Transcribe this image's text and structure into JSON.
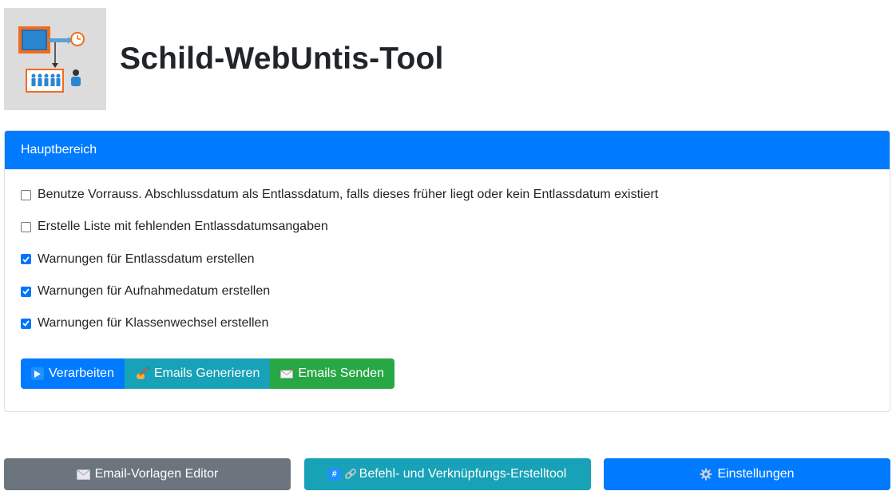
{
  "app": {
    "title": "Schild-WebUntis-Tool",
    "logo_icon": "school-schedule-logo-icon"
  },
  "card": {
    "header": "Hauptbereich",
    "options": [
      {
        "label": "Benutze Vorrauss. Abschlussdatum als Entlassdatum, falls dieses früher liegt oder kein Entlassdatum existiert",
        "checked": false
      },
      {
        "label": "Erstelle Liste mit fehlenden Entlassdatumsangaben",
        "checked": false
      },
      {
        "label": "Warnungen für Entlassdatum erstellen",
        "checked": true
      },
      {
        "label": "Warnungen für Aufnahmedatum erstellen",
        "checked": true
      },
      {
        "label": "Warnungen für Klassenwechsel erstellen",
        "checked": true
      }
    ],
    "actions": {
      "process": {
        "label": "Verarbeiten",
        "icon": "play-icon"
      },
      "generate": {
        "label": "Emails Generieren",
        "icon": "writing-hand-icon"
      },
      "send": {
        "label": "Emails Senden",
        "icon": "envelope-icon"
      }
    }
  },
  "footer": {
    "template_editor": {
      "label": "Email-Vorlagen Editor",
      "icon": "envelope-icon"
    },
    "command_tool": {
      "label": "Befehl- und Verknüpfungs-Erstelltool",
      "icons": [
        "hash-icon",
        "link-icon"
      ]
    },
    "settings": {
      "label": "Einstellungen",
      "icon": "gear-icon"
    }
  },
  "colors": {
    "primary": "#007bff",
    "info": "#17a2b8",
    "success": "#28a745",
    "secondary": "#6c757d"
  }
}
